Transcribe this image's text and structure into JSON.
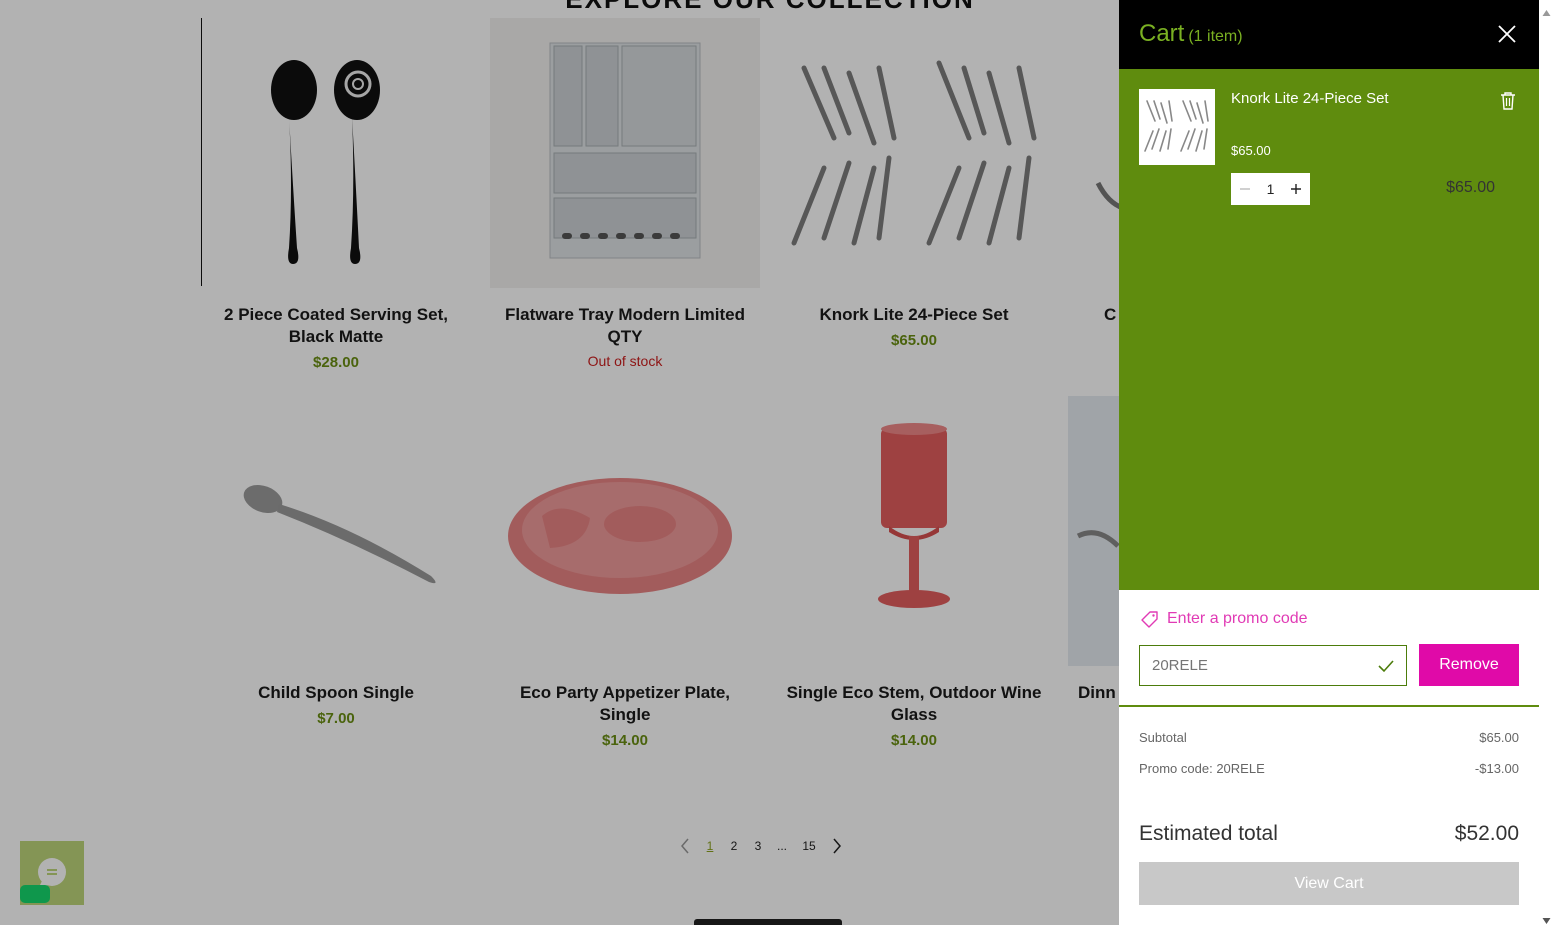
{
  "store": {
    "section_title": "EXPLORE OUR COLLECTION",
    "products": [
      {
        "name": "2 Piece Coated Serving Set, Black Matte",
        "price": "$28.00",
        "status": ""
      },
      {
        "name": "Flatware Tray Modern Limited QTY",
        "price": "",
        "status": "Out of stock"
      },
      {
        "name": "Knork Lite 24-Piece Set",
        "price": "$65.00",
        "status": ""
      },
      {
        "name": "C",
        "price": "",
        "status": ""
      },
      {
        "name": "Child Spoon Single",
        "price": "$7.00",
        "status": ""
      },
      {
        "name": "Eco Party Appetizer Plate, Single",
        "price": "$14.00",
        "status": ""
      },
      {
        "name": "Single Eco Stem, Outdoor Wine Glass",
        "price": "$14.00",
        "status": ""
      },
      {
        "name": "Dinn",
        "price": "",
        "status": ""
      }
    ],
    "pagination": {
      "pages": [
        "1",
        "2",
        "3",
        "...",
        "15"
      ],
      "current": "1"
    }
  },
  "cart": {
    "title": "Cart",
    "count_label": "(1 item)",
    "item": {
      "name": "Knork Lite 24-Piece Set",
      "unit_price": "$65.00",
      "quantity": "1",
      "line_total": "$65.00"
    },
    "promo": {
      "link_label": "Enter a promo code",
      "placeholder": "20RELE",
      "remove_label": "Remove"
    },
    "summary": {
      "subtotal_label": "Subtotal",
      "subtotal_value": "$65.00",
      "promo_label": "Promo code: 20RELE",
      "promo_value": "-$13.00",
      "estimated_label": "Estimated total",
      "estimated_value": "$52.00"
    },
    "view_cart_label": "View Cart"
  },
  "colors": {
    "accent_green": "#5f8c0e",
    "price_green": "#6b8f13",
    "promo_pink": "#e00aa8",
    "header_black": "#000000"
  },
  "icons": [
    "close-icon",
    "trash-icon",
    "minus-icon",
    "plus-icon",
    "tag-icon",
    "check-icon",
    "chevron-left-icon",
    "chevron-right-icon",
    "chat-icon"
  ]
}
